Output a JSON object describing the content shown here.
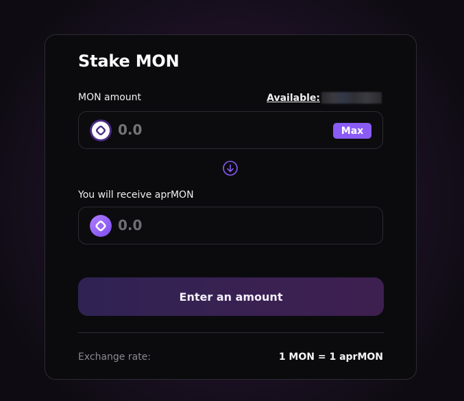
{
  "card": {
    "title": "Stake MON"
  },
  "input": {
    "label": "MON amount",
    "available_label": "Available:",
    "placeholder": "0.0",
    "max_label": "Max",
    "token_icon": "mon-token-icon"
  },
  "output": {
    "label": "You will receive aprMON",
    "value": "0.0",
    "token_icon": "aprmon-token-icon"
  },
  "swap_direction_icon": "arrow-down-circle-icon",
  "submit_label": "Enter an amount",
  "exchange": {
    "label": "Exchange rate:",
    "value": "1 MON = 1 aprMON"
  },
  "colors": {
    "accent": "#8a5cf5",
    "button_start": "#2f2353",
    "button_end": "#3e2050",
    "card_bg": "#0b0b0e",
    "muted_text": "#6e6e74"
  }
}
